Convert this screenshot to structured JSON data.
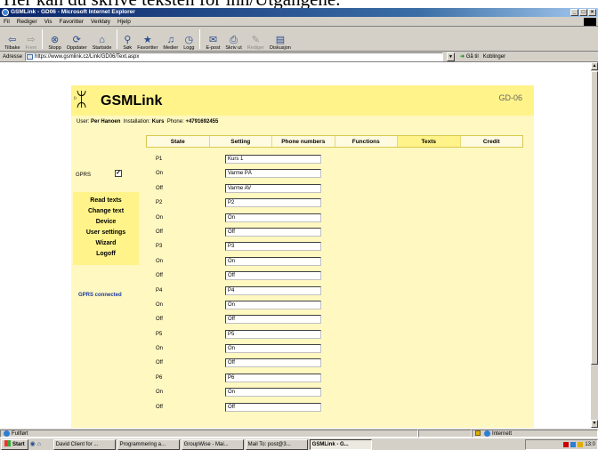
{
  "caption": "Her kan du skrive teksten for inn/Utgangene.",
  "window": {
    "title": "GSMLink - GD06 - Microsoft Internet Explorer",
    "buttons": [
      "_",
      "□",
      "×"
    ]
  },
  "menubar": [
    "Fil",
    "Rediger",
    "Vis",
    "Favoritter",
    "Verktøy",
    "Hjelp"
  ],
  "toolbar": [
    {
      "label": "Tilbake",
      "icon": "back-arrow-icon",
      "glyph": "⇦",
      "enabled": true
    },
    {
      "label": "Frem",
      "icon": "forward-arrow-icon",
      "glyph": "⇨",
      "enabled": false
    },
    {
      "label": "Stopp",
      "icon": "stop-icon",
      "glyph": "⊗",
      "enabled": true
    },
    {
      "label": "Oppdater",
      "icon": "refresh-icon",
      "glyph": "⟳",
      "enabled": true
    },
    {
      "label": "Startside",
      "icon": "home-icon",
      "glyph": "⌂",
      "enabled": true
    },
    {
      "label": "Søk",
      "icon": "search-icon",
      "glyph": "⚲",
      "enabled": true
    },
    {
      "label": "Favoritter",
      "icon": "favorites-icon",
      "glyph": "★",
      "enabled": true
    },
    {
      "label": "Medier",
      "icon": "media-icon",
      "glyph": "♫",
      "enabled": true
    },
    {
      "label": "Logg",
      "icon": "history-icon",
      "glyph": "◷",
      "enabled": true
    },
    {
      "label": "E-post",
      "icon": "mail-icon",
      "glyph": "✉",
      "enabled": true
    },
    {
      "label": "Skriv ut",
      "icon": "print-icon",
      "glyph": "⎙",
      "enabled": true
    },
    {
      "label": "Rediger",
      "icon": "edit-icon",
      "glyph": "✎",
      "enabled": false
    },
    {
      "label": "Diskusjon",
      "icon": "discussion-icon",
      "glyph": "▤",
      "enabled": true
    }
  ],
  "address": {
    "label": "Adresse",
    "url": "https://www.gsmlink.cz/Link/GD06/Text.aspx",
    "go": "Gå til",
    "links": "Koblinger"
  },
  "page": {
    "brand": "GSMLink",
    "device_code": "GD-06",
    "user_label": "User:",
    "user_name": "Per Hanoen",
    "installation_label": "Installation:",
    "installation_name": "Kurs",
    "phone_label": "Phone:",
    "phone_number": "+4791692455",
    "tabs": [
      {
        "label": "State",
        "active": false
      },
      {
        "label": "Setting",
        "active": false
      },
      {
        "label": "Phone numbers",
        "active": false
      },
      {
        "label": "Functions",
        "active": false
      },
      {
        "label": "Texts",
        "active": true
      },
      {
        "label": "Credit",
        "active": false
      }
    ],
    "gprs_label": "GPRS",
    "gprs_checked": true,
    "side_menu": [
      "Read texts",
      "Change text",
      "Device",
      "User settings",
      "Wizard",
      "Logoff"
    ],
    "gprs_status": "GPRS connected",
    "rows": [
      {
        "label": "P1",
        "value": "Kurs 1"
      },
      {
        "label": "On",
        "value": "Varme PÅ"
      },
      {
        "label": "Off",
        "value": "Varme AV"
      },
      {
        "label": "P2",
        "value": "P2"
      },
      {
        "label": "On",
        "value": "On"
      },
      {
        "label": "Off",
        "value": "Off"
      },
      {
        "label": "P3",
        "value": "P3"
      },
      {
        "label": "On",
        "value": "On"
      },
      {
        "label": "Off",
        "value": "Off"
      },
      {
        "label": "P4",
        "value": "P4"
      },
      {
        "label": "On",
        "value": "On"
      },
      {
        "label": "Off",
        "value": "Off"
      },
      {
        "label": "P5",
        "value": "P5"
      },
      {
        "label": "On",
        "value": "On"
      },
      {
        "label": "Off",
        "value": "Off"
      },
      {
        "label": "P6",
        "value": "P6"
      },
      {
        "label": "On",
        "value": "On"
      },
      {
        "label": "Off",
        "value": "Off"
      }
    ]
  },
  "statusbar": {
    "text": "Fullført",
    "zone": "Internett"
  },
  "taskbar": {
    "start": "Start",
    "tasks": [
      {
        "label": "David Client for ...",
        "active": false
      },
      {
        "label": "Programmering a...",
        "active": false
      },
      {
        "label": "GroupWise - Mai...",
        "active": false
      },
      {
        "label": "Mail To: post@3...",
        "active": false
      },
      {
        "label": "GSMLink - G...",
        "active": true
      }
    ],
    "clock": "13:0"
  },
  "colors": {
    "header_yellow": "#fff38a",
    "page_yellow": "#fff8c0",
    "status_blue": "#1a3aa0"
  }
}
